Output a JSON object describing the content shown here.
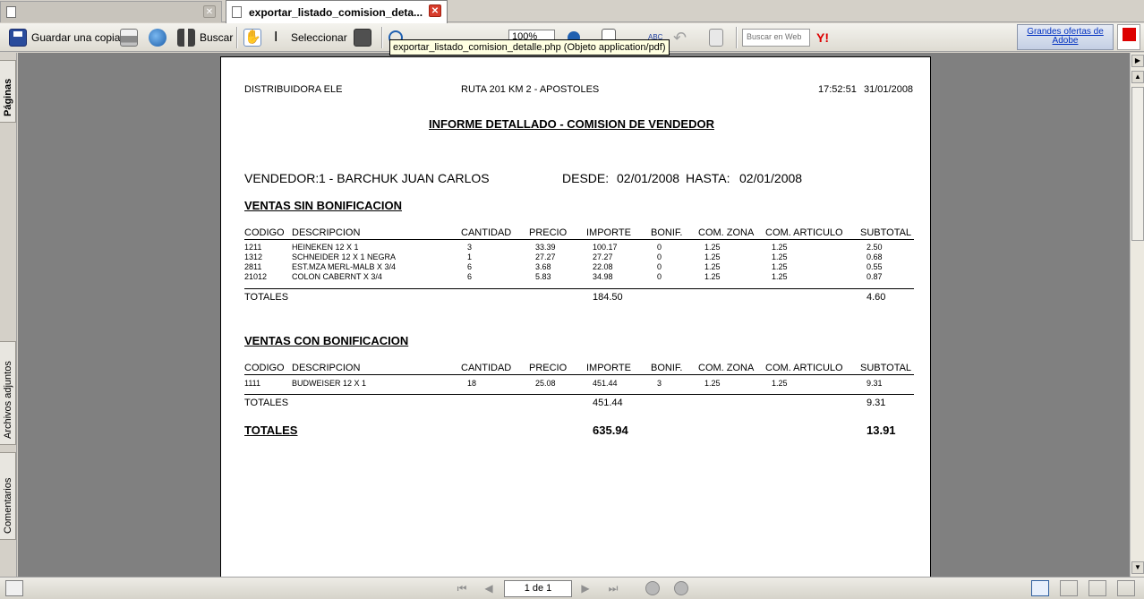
{
  "tabs": [
    {
      "label": ""
    },
    {
      "label": "exportar_listado_comision_deta..."
    }
  ],
  "toolbar": {
    "save_label": "Guardar una copia",
    "search_label": "Buscar",
    "select_label": "Seleccionar",
    "zoom_value": "100%",
    "search_web_placeholder": "Buscar en Web",
    "ad_text": "Grandes ofertas de Adobe",
    "tooltip": "exportar_listado_comision_detalle.php (Objeto application/pdf)"
  },
  "side_tabs": {
    "pages": "Páginas",
    "attachments": "Archivos adjuntos",
    "comments": "Comentarios"
  },
  "report": {
    "company": "DISTRIBUIDORA ELE",
    "address": "RUTA 201 KM 2 - APOSTOLES",
    "time": "17:52:51",
    "date": "31/01/2008",
    "title": "INFORME DETALLADO - COMISION DE VENDEDOR",
    "vendor_label": "VENDEDOR:",
    "vendor_value": "1 - BARCHUK JUAN CARLOS",
    "from_label": "DESDE:",
    "from_value": "02/01/2008",
    "to_label": "HASTA:",
    "to_value": "02/01/2008",
    "columns": [
      "CODIGO",
      "DESCRIPCION",
      "CANTIDAD",
      "PRECIO",
      "IMPORTE",
      "BONIF.",
      "COM. ZONA",
      "COM. ARTICULO",
      "SUBTOTAL"
    ],
    "section1": {
      "title": "VENTAS SIN BONIFICACION",
      "rows": [
        [
          "1211",
          "HEINEKEN 12 X 1",
          "3",
          "33.39",
          "100.17",
          "0",
          "1.25",
          "1.25",
          "2.50"
        ],
        [
          "1312",
          "SCHNEIDER 12 X 1 NEGRA",
          "1",
          "27.27",
          "27.27",
          "0",
          "1.25",
          "1.25",
          "0.68"
        ],
        [
          "2811",
          "EST.MZA MERL-MALB X 3/4",
          "6",
          "3.68",
          "22.08",
          "0",
          "1.25",
          "1.25",
          "0.55"
        ],
        [
          "21012",
          "COLON CABERNT X 3/4",
          "6",
          "5.83",
          "34.98",
          "0",
          "1.25",
          "1.25",
          "0.87"
        ]
      ],
      "totals_label": "TOTALES",
      "total_importe": "184.50",
      "total_subtotal": "4.60"
    },
    "section2": {
      "title": "VENTAS CON BONIFICACION",
      "rows": [
        [
          "1111",
          "BUDWEISER 12 X 1",
          "18",
          "25.08",
          "451.44",
          "3",
          "1.25",
          "1.25",
          "9.31"
        ]
      ],
      "totals_label": "TOTALES",
      "total_importe": "451.44",
      "total_subtotal": "9.31"
    },
    "grand_total_label": "TOTALES",
    "grand_total_importe": "635.94",
    "grand_total_subtotal": "13.91"
  },
  "statusbar": {
    "page_indicator": "1 de 1"
  }
}
